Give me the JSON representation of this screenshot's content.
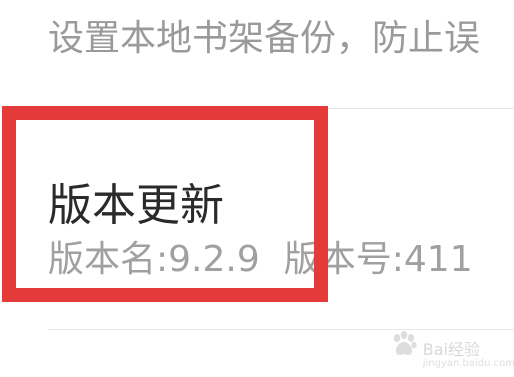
{
  "backup_setting": {
    "description": "设置本地书架备份，防止误"
  },
  "version_update": {
    "title": "版本更新",
    "version_name_label": "版本名:",
    "version_name": "9.2.9",
    "version_code_label": "版本号:",
    "version_code": "411"
  },
  "annotation": {
    "highlight_color": "#e53a3a"
  },
  "watermark": {
    "brand": "Bai",
    "brand_suffix": "经验",
    "url": "jingyan.baidu.com",
    "icon": "paw-icon"
  }
}
